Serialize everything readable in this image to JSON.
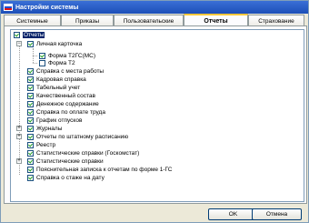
{
  "window": {
    "title": "Настройки системы"
  },
  "tabs": [
    {
      "label": "Системные"
    },
    {
      "label": "Приказы"
    },
    {
      "label": "Пользовательские"
    },
    {
      "label": "Отчеты"
    },
    {
      "label": "Страхование"
    }
  ],
  "tree": {
    "root": {
      "label": "Отчеты",
      "checked": true
    },
    "items": [
      {
        "label": "Личная карточка",
        "checked": true
      },
      {
        "label": "Форма Т2ГС(МС)",
        "checked": true
      },
      {
        "label": "Форма Т2",
        "checked": false
      },
      {
        "label": "Справка с места работы",
        "checked": true
      },
      {
        "label": "Кадровая справка",
        "checked": true
      },
      {
        "label": "Табельный учет",
        "checked": true
      },
      {
        "label": "Качественный состав",
        "checked": true
      },
      {
        "label": "Денежное содержание",
        "checked": true
      },
      {
        "label": "Справка по оплате труда",
        "checked": true
      },
      {
        "label": "График отпусков",
        "checked": true
      },
      {
        "label": "Журналы",
        "checked": true
      },
      {
        "label": "Отчеты по штатному расписанию",
        "checked": true
      },
      {
        "label": "Реестр",
        "checked": true
      },
      {
        "label": "Статистические справки (Госкомстат)",
        "checked": true
      },
      {
        "label": "Статистические справки",
        "checked": true
      },
      {
        "label": "Пояснительная записка к отчетам по форме 1-ГС",
        "checked": true
      },
      {
        "label": "Справка о стаже на дату",
        "checked": true
      }
    ]
  },
  "buttons": {
    "ok": "OK",
    "cancel": "Отмена"
  }
}
